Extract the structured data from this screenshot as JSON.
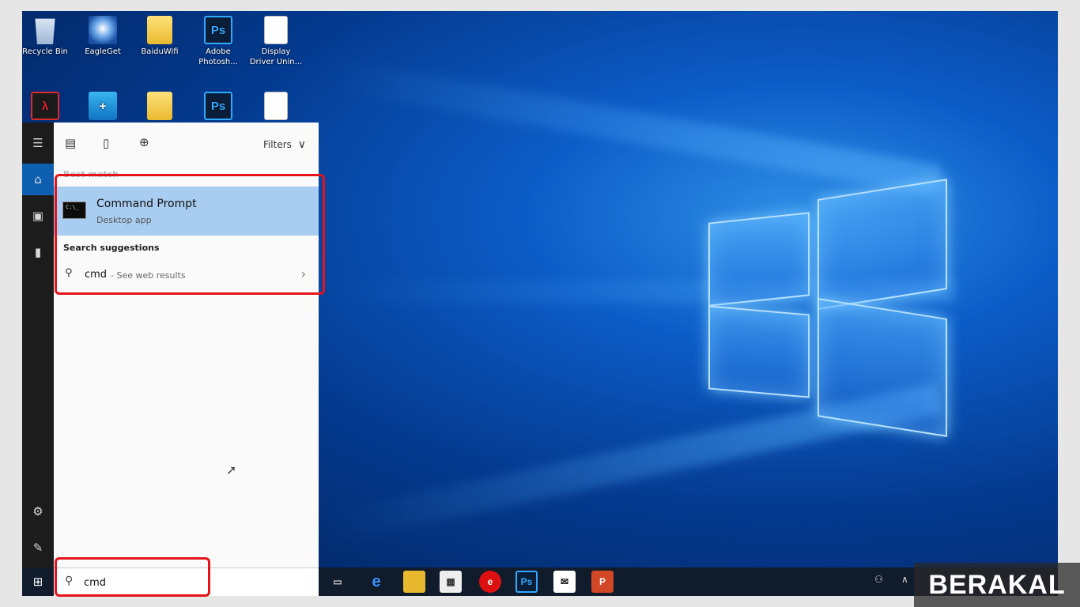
{
  "desktop": {
    "icons": [
      {
        "label": "Recycle Bin"
      },
      {
        "label": "EagleGet"
      },
      {
        "label": "BaiduWifi"
      },
      {
        "label": "Adobe Photosh..."
      },
      {
        "label": "Display Driver Unin..."
      }
    ]
  },
  "search_panel": {
    "filters_label": "Filters",
    "best_match_label": "Best match",
    "result": {
      "title": "Command Prompt",
      "subtitle": "Desktop app"
    },
    "suggestions_label": "Search suggestions",
    "suggestion": {
      "query": "cmd",
      "hint": "- See web results"
    }
  },
  "search_box": {
    "value": "cmd"
  },
  "taskbar": {
    "apps": [
      "task-view",
      "edge",
      "file-explorer",
      "store",
      "app-red",
      "photoshop",
      "mail",
      "powerpoint"
    ],
    "ps_label": "Ps"
  },
  "watermark": {
    "text": "BERAKAL"
  },
  "colors": {
    "highlight": "#e3141b",
    "selection": "#a9cdf0",
    "accent": "#0e5fb0"
  }
}
